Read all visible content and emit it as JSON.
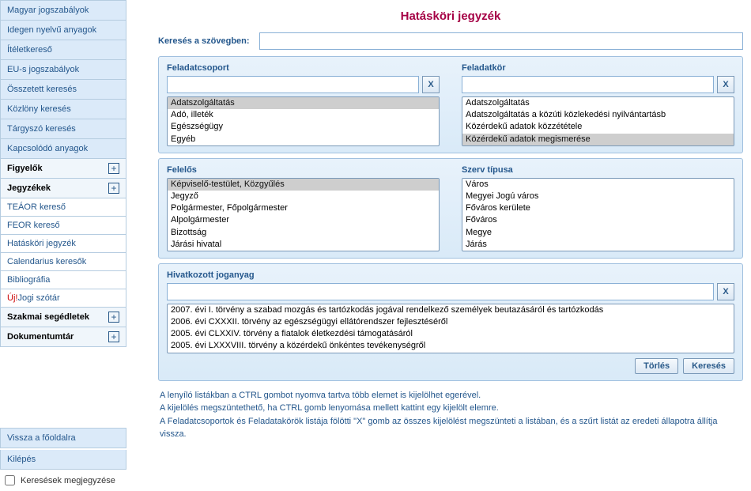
{
  "nav": {
    "items": [
      "Magyar jogszabályok",
      "Idegen nyelvű anyagok",
      "Ítéletkereső",
      "EU-s jogszabályok",
      "Összetett keresés",
      "Közlöny keresés",
      "Tárgyszó keresés",
      "Kapcsolódó anyagok"
    ],
    "sections": {
      "figyelok": "Figyelők",
      "jegyzekek": "Jegyzékek",
      "jegyzekek_items": [
        "TEÁOR kereső",
        "FEOR kereső",
        "Hatásköri jegyzék",
        "Calendarius keresők",
        "Bibliográfia"
      ],
      "uj_jogi": "Új!Jogi szótár",
      "uj_prefix": "Új!",
      "uj_rest": "Jogi szótár",
      "szakmai": "Szakmai segédletek",
      "dokutar": "Dokumentumtár"
    },
    "bottom": {
      "fooldal": "Vissza a főoldalra",
      "kilepes": "Kilépés",
      "keres_cb": "Keresések megjegyzése"
    },
    "expand": "+"
  },
  "main": {
    "title": "Hatásköri jegyzék",
    "search_text_label": "Keresés a szövegben:",
    "feladatcsoport": {
      "label": "Feladatcsoport",
      "x": "X",
      "options": [
        "Adatszolgáltatás",
        "Adó, illeték",
        "Egészségügy",
        "Egyéb"
      ],
      "selected": "Adatszolgáltatás"
    },
    "feladatkor": {
      "label": "Feladatkör",
      "x": "X",
      "options": [
        "Adatszolgáltatás",
        "Adatszolgáltatás a közúti közlekedési nyilvántartásb",
        "Közérdekű adatok közzététele",
        "Közérdekű adatok megismerése"
      ],
      "selected": "Közérdekű adatok megismerése"
    },
    "felelos": {
      "label": "Felelős",
      "options": [
        "Képviselő-testület, Közgyűlés",
        "Jegyző",
        "Polgármester, Főpolgármester",
        "Alpolgármester",
        "Bizottság",
        "Járási hivatal"
      ],
      "selected": "Képviselő-testület, Közgyűlés"
    },
    "szervtipus": {
      "label": "Szerv típusa",
      "options": [
        "Város",
        "Megyei Jogú város",
        "Főváros kerülete",
        "Főváros",
        "Megye",
        "Járás"
      ]
    },
    "hivatkozott": {
      "label": "Hivatkozott joganyag",
      "x": "X",
      "options": [
        "2007. évi I. törvény a szabad mozgás és tartózkodás jogával rendelkező személyek beutazásáról és tartózkodás",
        "2006. évi CXXXII. törvény az egészségügyi ellátórendszer fejlesztéséről",
        "2005. évi CLXXIV. törvény a fiatalok életkezdési támogatásáról",
        "2005. évi LXXXVIII. törvény a közérdekű önkéntes tevékenységről"
      ]
    },
    "buttons": {
      "clear": "Törlés",
      "search": "Keresés"
    },
    "help": [
      "A lenyíló listákban a CTRL gombot nyomva tartva több elemet is kijelölhet egerével.",
      "A kijelölés megszüntethető, ha CTRL gomb lenyomása mellett kattint egy kijelölt elemre.",
      "A Feladatcsoportok és Feladatakörök listája fölötti \"X\" gomb az összes kijelölést megszünteti a listában, és a szűrt listát az eredeti állapotra állítja vissza."
    ]
  }
}
